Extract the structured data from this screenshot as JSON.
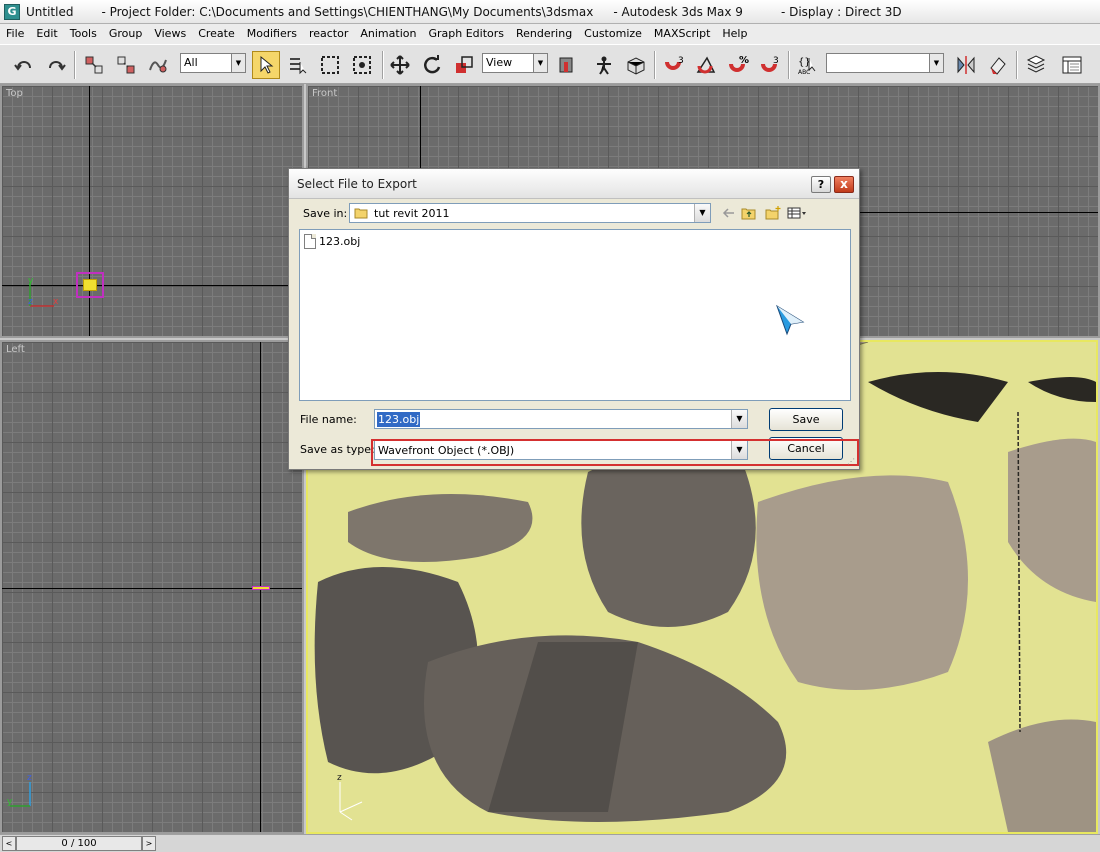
{
  "window": {
    "doc": "Untitled",
    "project": "- Project Folder: C:\\Documents and Settings\\CHIENTHANG\\My Documents\\3dsmax",
    "app": "- Autodesk 3ds Max 9",
    "display": "- Display : Direct 3D"
  },
  "menu": [
    "File",
    "Edit",
    "Tools",
    "Group",
    "Views",
    "Create",
    "Modifiers",
    "reactor",
    "Animation",
    "Graph Editors",
    "Rendering",
    "Customize",
    "MAXScript",
    "Help"
  ],
  "toolbar": {
    "selection_filter": "All",
    "reference_coord": "View",
    "named_selection": "",
    "angle_snap_label": "3",
    "percent_label": "%",
    "spinner_label": "3"
  },
  "viewports": {
    "top": "Top",
    "front": "Front",
    "left": "Left",
    "axis_x": "x",
    "axis_y": "y",
    "axis_z": "z"
  },
  "timeslider": {
    "value": "0 / 100",
    "prev": "<",
    "next": ">"
  },
  "dialog": {
    "title": "Select File to Export",
    "help": "?",
    "close": "x",
    "save_in_label": "Save in:",
    "save_in_value": "tut revit 2011",
    "files": [
      "123.obj"
    ],
    "file_name_label": "File name:",
    "file_name_value": "123.obj",
    "save_as_type_label": "Save as type:",
    "save_as_type_value": "Wavefront Object (*.OBJ)",
    "save_button": "Save",
    "cancel_button": "Cancel"
  },
  "colors": {
    "perspective_border": "#e8e860",
    "highlight_box": "#d43030",
    "selection_blue": "#316ac5"
  }
}
